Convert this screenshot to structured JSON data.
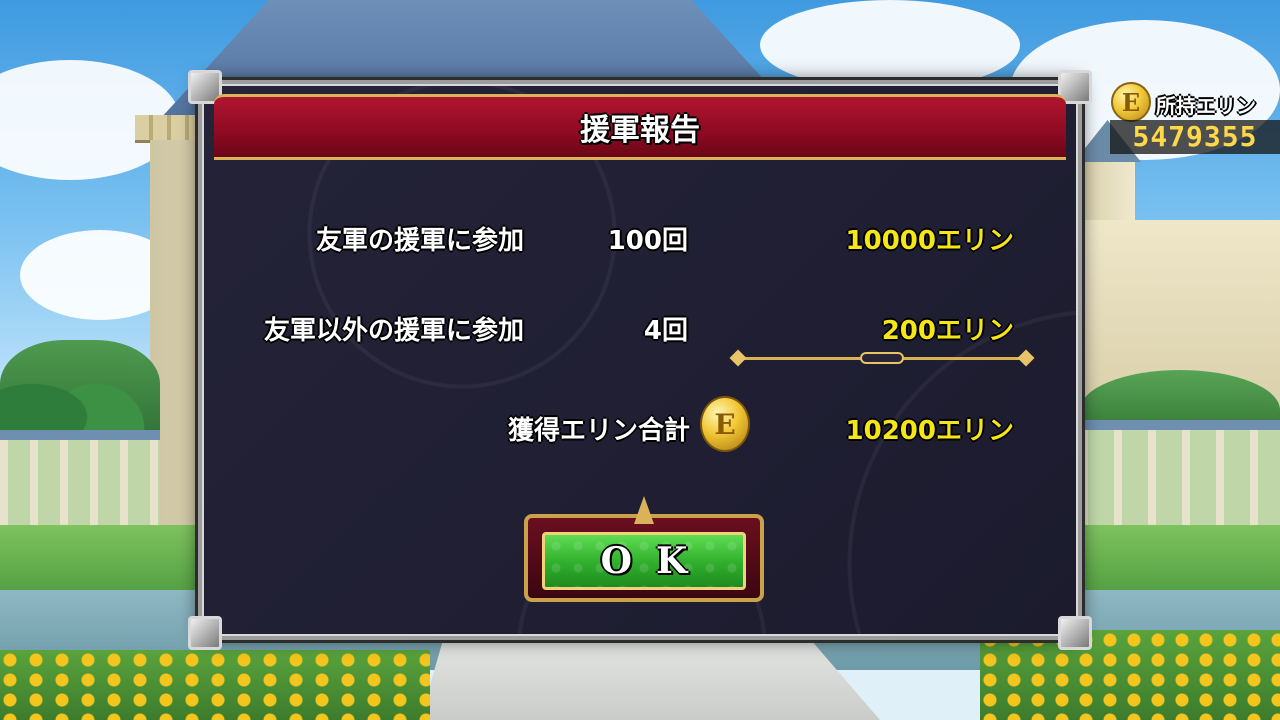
{
  "currency": {
    "icon": "e-coin-icon",
    "coin_letter": "E",
    "label": "所持エリン",
    "amount": "5479355"
  },
  "dialog": {
    "title": "援軍報告",
    "rows": [
      {
        "label": "友軍の援軍に参加",
        "count": "100回",
        "amount": "10000エリン"
      },
      {
        "label": "友軍以外の援軍に参加",
        "count": "4回",
        "amount": "200エリン"
      }
    ],
    "total": {
      "label": "獲得エリン合計",
      "icon": "e-coin-icon",
      "coin_letter": "E",
      "amount": "10200エリン"
    },
    "ok_label": "OK"
  },
  "colors": {
    "header_red": "#9e0f28",
    "panel_navy": "#1f1e33",
    "amount_yellow": "#f6e614",
    "ok_green": "#2fae2c",
    "gold_trim": "#d9b25a"
  }
}
